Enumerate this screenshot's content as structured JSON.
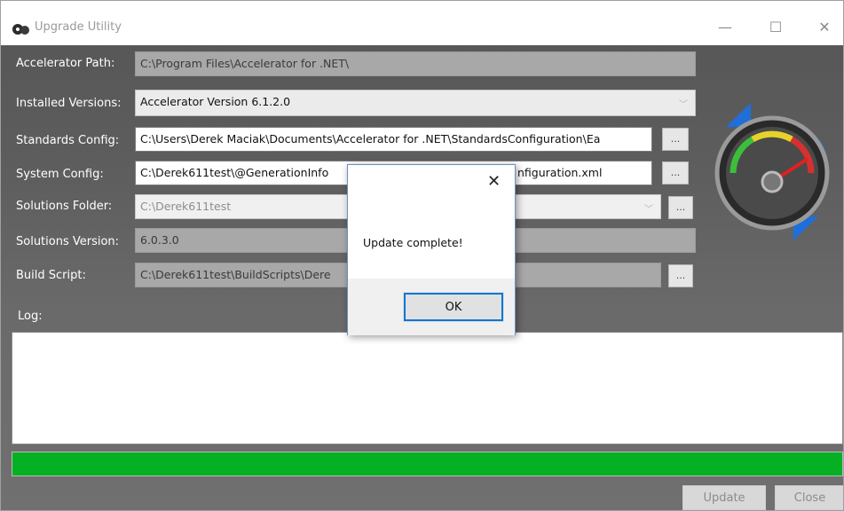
{
  "window": {
    "title": "Upgrade Utility",
    "controls": {
      "minimize": "—",
      "maximize": "☐",
      "close": "✕"
    }
  },
  "form": {
    "accelerator_path": {
      "label": "Accelerator Path:",
      "value": "C:\\Program Files\\Accelerator for .NET\\"
    },
    "installed_versions": {
      "label": "Installed Versions:",
      "value": "Accelerator Version 6.1.2.0"
    },
    "standards_config": {
      "label": "Standards Config:",
      "value": "C:\\Users\\Derek Maciak\\Documents\\Accelerator for .NET\\StandardsConfiguration\\Ea"
    },
    "system_config": {
      "label": "System Config:",
      "value": "C:\\Derek611test\\@GenerationInfo",
      "value_tail": "nfiguration.xml"
    },
    "solutions_folder": {
      "label": "Solutions Folder:",
      "value": "C:\\Derek611test"
    },
    "solutions_version": {
      "label": "Solutions Version:",
      "value": "6.0.3.0"
    },
    "build_script": {
      "label": "Build Script:",
      "value": "C:\\Derek611test\\BuildScripts\\Dere"
    },
    "browse_label": "...",
    "browse_small_label": "..."
  },
  "log": {
    "label": "Log:",
    "content": ""
  },
  "progress": {
    "percent": 100,
    "color": "#06b025"
  },
  "footer": {
    "update_label": "Update",
    "close_label": "Close"
  },
  "dialog": {
    "message": "Update complete!",
    "ok_label": "OK",
    "close_glyph": "✕"
  },
  "colors": {
    "accent": "#0078d7",
    "progress": "#06b025",
    "background": "#5e5e5e"
  },
  "icons": [
    "app-logo-icon",
    "chevron-down-icon",
    "speedometer-sync-icon"
  ]
}
